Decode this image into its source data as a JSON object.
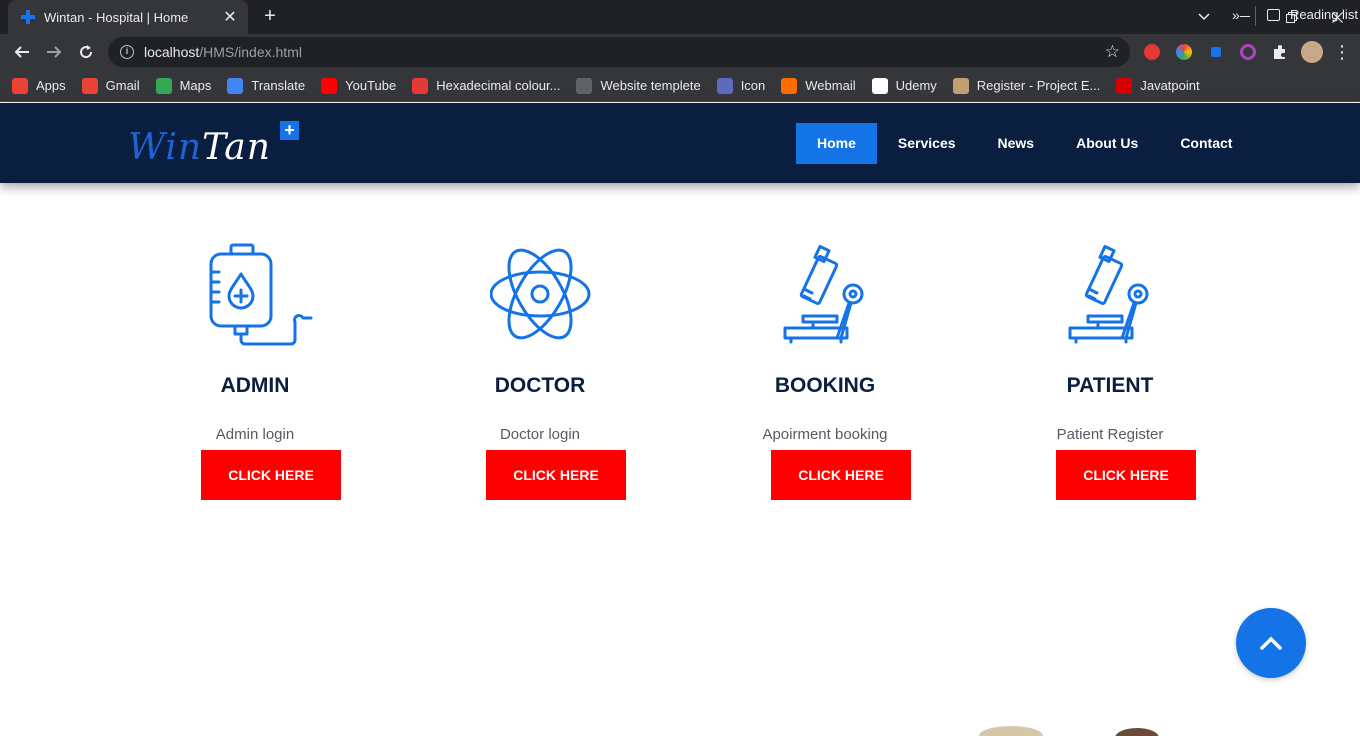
{
  "browser": {
    "tab_title": "Wintan - Hospital | Home",
    "url_host": "localhost",
    "url_path": "/HMS/index.html",
    "bookmarks": [
      {
        "label": "Apps",
        "icon": "apps-grid-icon",
        "color": "#ea4335"
      },
      {
        "label": "Gmail",
        "icon": "gmail-icon",
        "color": "#ea4335"
      },
      {
        "label": "Maps",
        "icon": "maps-icon",
        "color": "#34a853"
      },
      {
        "label": "Translate",
        "icon": "translate-icon",
        "color": "#4285f4"
      },
      {
        "label": "YouTube",
        "icon": "youtube-icon",
        "color": "#ff0000"
      },
      {
        "label": "Hexadecimal colour...",
        "icon": "hex-color-icon",
        "color": "#e53935"
      },
      {
        "label": "Website templete",
        "icon": "template-icon",
        "color": "#5f6368"
      },
      {
        "label": "Icon",
        "icon": "icon-site-icon",
        "color": "#5c6bc0"
      },
      {
        "label": "Webmail",
        "icon": "webmail-icon",
        "color": "#ff6d00"
      },
      {
        "label": "Udemy",
        "icon": "udemy-icon",
        "color": "#ffffff"
      },
      {
        "label": "Register - Project E...",
        "icon": "register-icon",
        "color": "#c0a070"
      },
      {
        "label": "Javatpoint",
        "icon": "javatpoint-icon",
        "color": "#d50000"
      }
    ],
    "reading_list": "Reading list"
  },
  "site": {
    "logo": {
      "part1": "Win",
      "part2": "Tan",
      "plus": "+"
    },
    "nav": [
      {
        "label": "Home",
        "active": true
      },
      {
        "label": "Services",
        "active": false
      },
      {
        "label": "News",
        "active": false
      },
      {
        "label": "About Us",
        "active": false
      },
      {
        "label": "Contact",
        "active": false
      }
    ],
    "cards": [
      {
        "title": "ADMIN",
        "desc": "Admin login",
        "button": "CLICK HERE",
        "icon": "iv-bag-icon"
      },
      {
        "title": "DOCTOR",
        "desc": "Doctor login",
        "button": "CLICK HERE",
        "icon": "atom-icon"
      },
      {
        "title": "BOOKING",
        "desc": "Apoirment booking",
        "button": "CLICK HERE",
        "icon": "microscope-icon"
      },
      {
        "title": "PATIENT",
        "desc": "Patient Register",
        "button": "CLICK HERE",
        "icon": "microscope-icon"
      }
    ]
  },
  "colors": {
    "header_bg": "#0a1e3f",
    "accent": "#1473e6",
    "button_red": "#ff0000"
  }
}
